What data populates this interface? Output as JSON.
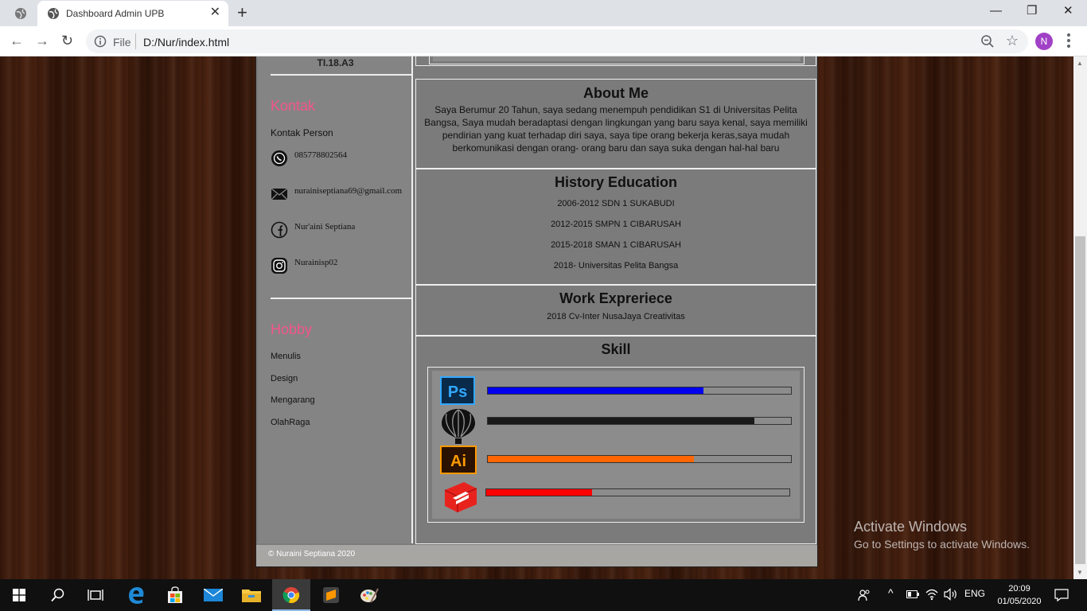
{
  "browser": {
    "tab_title": "Dashboard Admin UPB",
    "tab_close": "✕",
    "new_tab": "+",
    "back": "←",
    "forward": "→",
    "reload": "↻",
    "scheme": "File",
    "url": "D:/Nur/index.html",
    "profile_initial": "N",
    "window_controls": {
      "minimize": "—",
      "maximize": "❐",
      "close": "✕"
    },
    "bookmark_star": "☆"
  },
  "sidebar": {
    "class": "TI.18.A3",
    "contact_title": "Kontak",
    "contact_person_label": "Kontak Person",
    "contacts": [
      {
        "icon": "whatsapp-icon",
        "text": "085778802564"
      },
      {
        "icon": "mail-icon",
        "text": "nurainiseptiana69@gmail.com"
      },
      {
        "icon": "facebook-icon",
        "text": "Nur'aini Septiana"
      },
      {
        "icon": "instagram-icon",
        "text": "Nurainisp02"
      }
    ],
    "hobby_title": "Hobby",
    "hobbies": [
      "Menulis",
      "Design",
      "Mengarang",
      "OlahRaga"
    ]
  },
  "main": {
    "about_title": "About Me",
    "about_text": "Saya Berumur 20 Tahun, saya sedang menempuh pendidikan S1 di Universitas Pelita Bangsa, Saya mudah beradaptasi dengan lingkungan yang baru saya kenal, saya memiliki pendirian yang kuat terhadap diri saya, saya tipe orang bekerja keras,saya mudah berkomunikasi dengan orang- orang baru dan saya suka dengan hal-hal baru",
    "education_title": "History Education",
    "education": [
      "2006-2012 SDN 1 SUKABUDI",
      "2012-2015 SMPN 1 CIBARUSAH",
      "2015-2018 SMAN 1 CIBARUSAH",
      "2018- Universitas Pelita Bangsa"
    ],
    "work_title": "Work Expreriece",
    "work": "2018 Cv-Inter NusaJaya Creativitas",
    "skill_title": "Skill",
    "skills": [
      {
        "name": "Photoshop",
        "icon": "photoshop-icon",
        "icon_text": "Ps",
        "level": 0.71,
        "color": "#0000ee"
      },
      {
        "name": "CorelDRAW",
        "icon": "coreldraw-icon",
        "level": 0.88,
        "color": "#1a1a1a"
      },
      {
        "name": "Illustrator",
        "icon": "illustrator-icon",
        "icon_text": "Ai",
        "level": 0.68,
        "color": "#ff6600"
      },
      {
        "name": "SketchUp",
        "icon": "sketchup-icon",
        "level": 0.35,
        "color": "#ff0000"
      }
    ]
  },
  "footer": {
    "text": "© Nuraini Septiana 2020"
  },
  "watermark": {
    "line1": "Activate Windows",
    "line2": "Go to Settings to activate Windows."
  },
  "taskbar": {
    "language": "ENG",
    "time": "20:09",
    "date": "01/05/2020"
  }
}
